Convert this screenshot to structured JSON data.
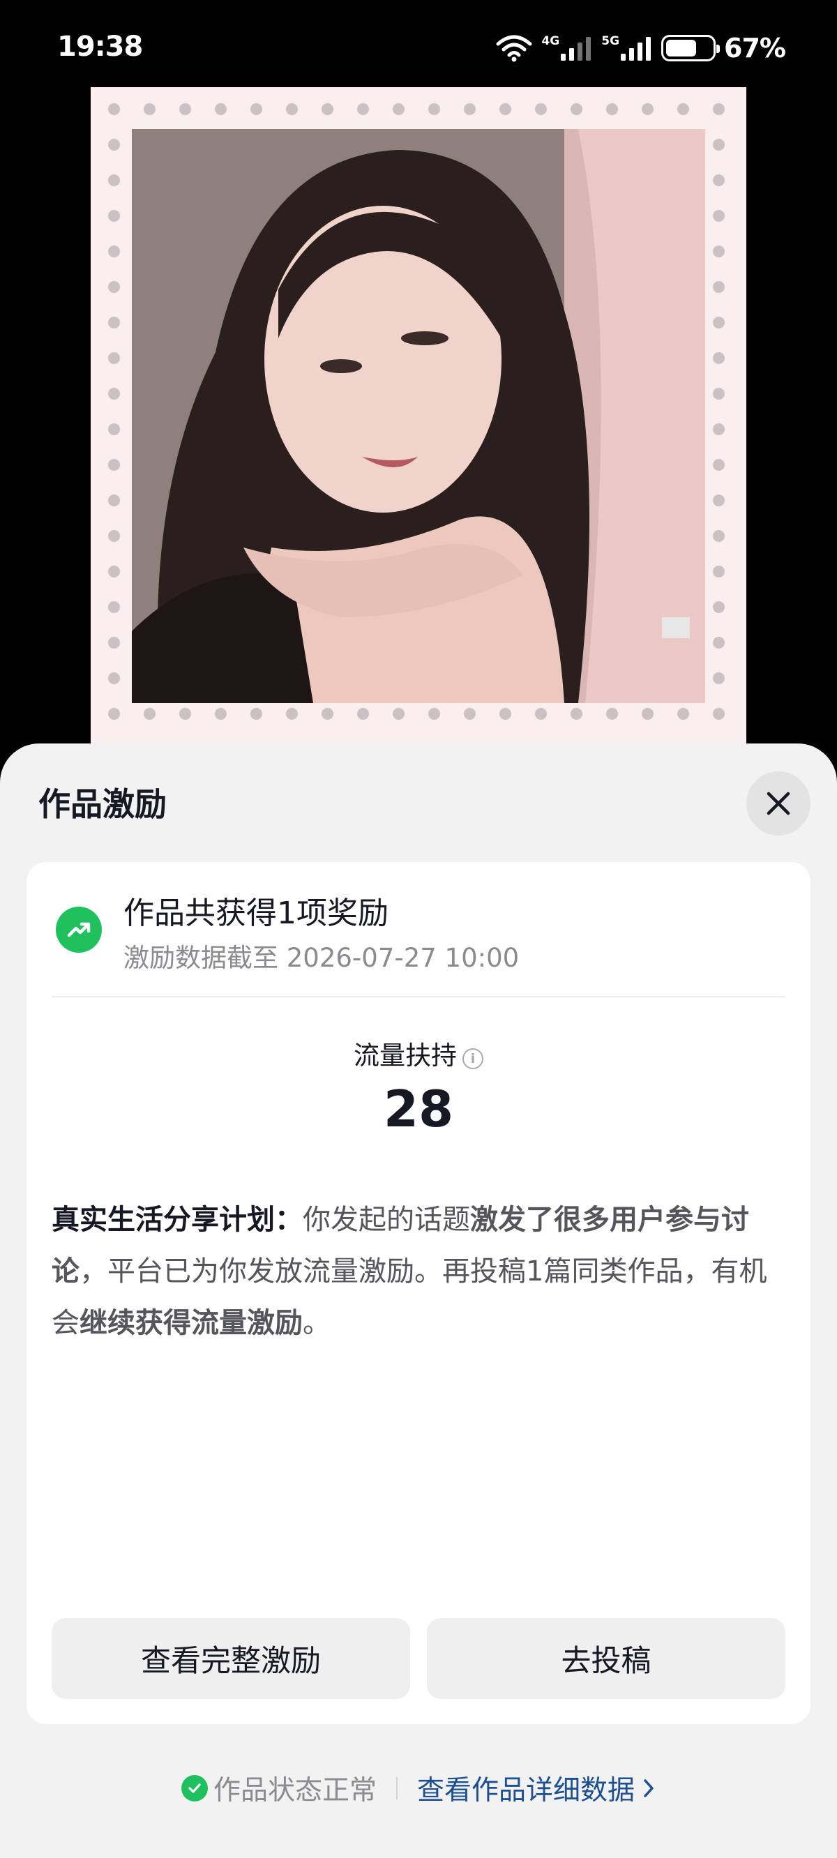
{
  "status_bar": {
    "time": "19:38",
    "net1": "4G",
    "net2": "5G",
    "battery_pct": "67%",
    "battery_level": 0.67
  },
  "sheet": {
    "title": "作品激励",
    "close_icon": "close-icon"
  },
  "reward": {
    "icon": "trending-up-icon",
    "icon_color": "#1fc15e",
    "title": "作品共获得1项奖励",
    "subtitle": "激励数据截至 2026-07-27 10:00"
  },
  "metric": {
    "label": "流量扶持",
    "value": "28"
  },
  "description": {
    "lead": "真实生活分享计划：",
    "part1": "你发起的话题",
    "bold1": "激发了很多用户参与讨论",
    "part2": "，平台已为你发放流量激励。再投稿1篇同类作品，有机会",
    "bold2": "继续获得流量激励",
    "part3": "。"
  },
  "buttons": {
    "view_full": "查看完整激励",
    "post": "去投稿"
  },
  "footer": {
    "status": "作品状态正常",
    "link": "查看作品详细数据",
    "link_color": "#1d4f91"
  }
}
